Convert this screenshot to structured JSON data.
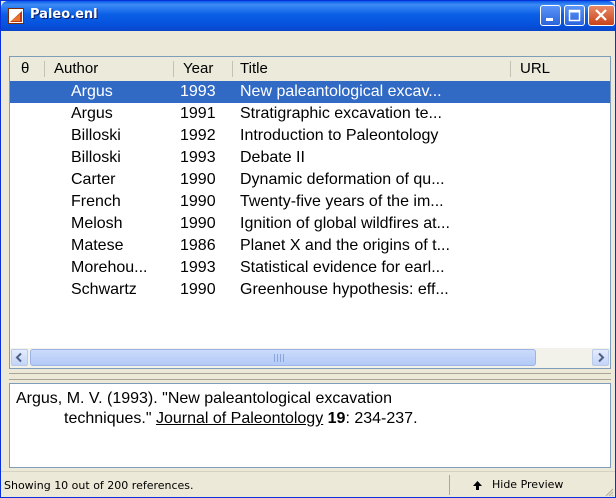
{
  "window": {
    "title": "Paleo.enl"
  },
  "list": {
    "columns": {
      "attachment": "θ",
      "author": "Author",
      "year": "Year",
      "title": "Title",
      "url": "URL"
    },
    "rows": [
      {
        "author": "Argus",
        "year": "1993",
        "title": "New paleantological excav..."
      },
      {
        "author": "Argus",
        "year": "1991",
        "title": "Stratigraphic excavation te..."
      },
      {
        "author": "Billoski",
        "year": "1992",
        "title": "Introduction to Paleontology"
      },
      {
        "author": "Billoski",
        "year": "1993",
        "title": "Debate II"
      },
      {
        "author": "Carter",
        "year": "1990",
        "title": "Dynamic deformation of qu..."
      },
      {
        "author": "French",
        "year": "1990",
        "title": "Twenty-five years of the im..."
      },
      {
        "author": "Melosh",
        "year": "1990",
        "title": "Ignition of global wildfires at..."
      },
      {
        "author": "Matese",
        "year": "1986",
        "title": "Planet X and the origins of t..."
      },
      {
        "author": "Morehou...",
        "year": "1993",
        "title": "Statistical evidence for earl..."
      },
      {
        "author": "Schwartz",
        "year": "1990",
        "title": "Greenhouse hypothesis: eff..."
      }
    ],
    "selected_index": 0
  },
  "preview": {
    "line1": "Argus, M. V. (1993). \"New paleantological excavation",
    "line2_prefix": "techniques.\" ",
    "journal": "Journal of Paleontology",
    "volume": "19",
    "pages": ": 234-237."
  },
  "status": {
    "text": "Showing 10 out of 200 references.",
    "hide_preview": "Hide Preview"
  },
  "colors": {
    "selection": "#316ac5",
    "titlebar": "#0a5fe6"
  },
  "icons": {
    "app": "endnote-app-icon",
    "attachment_column": "attachment-icon",
    "hide_preview": "up-arrow-icon"
  }
}
